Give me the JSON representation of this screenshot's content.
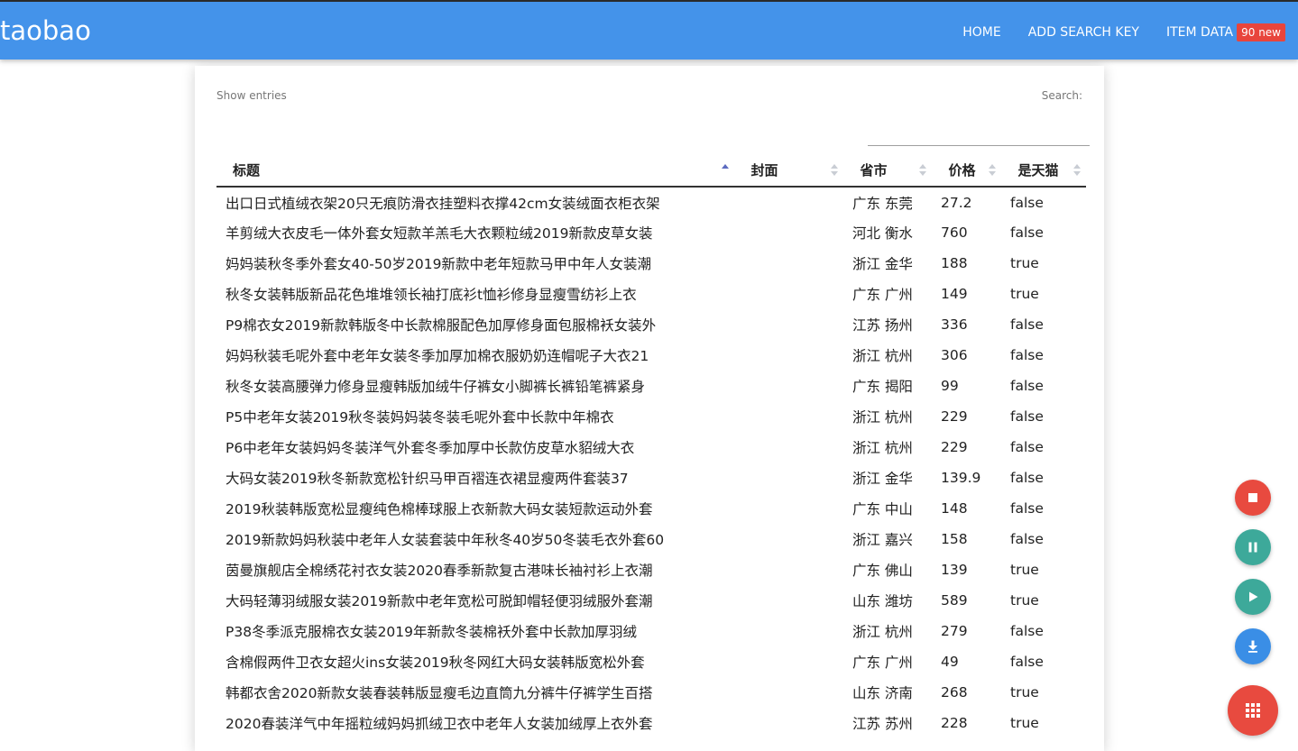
{
  "navbar": {
    "brand": "taobao",
    "links": {
      "home": "HOME",
      "add_search_key": "ADD SEARCH KEY",
      "item_data": "ITEM DATA"
    },
    "badge": "90 new"
  },
  "table_controls": {
    "show_entries": "Show entries",
    "search_label": "Search:",
    "search_value": ""
  },
  "table": {
    "columns": [
      "标题",
      "封面",
      "省市",
      "价格",
      "是天猫"
    ],
    "sorted_column": "标题",
    "sort_direction": "ascending",
    "rows": [
      {
        "title": "出口日式植绒衣架20只无痕防滑衣挂塑料衣撑42cm女装绒面衣柜衣架",
        "cover": "",
        "location": "广东 东莞",
        "price": "27.2",
        "tmall": "false"
      },
      {
        "title": "羊剪绒大衣皮毛一体外套女短款羊羔毛大衣颗粒绒2019新款皮草女装",
        "cover": "",
        "location": "河北 衡水",
        "price": "760",
        "tmall": "false"
      },
      {
        "title": "妈妈装秋冬季外套女40-50岁2019新款中老年短款马甲中年人女装潮",
        "cover": "",
        "location": "浙江 金华",
        "price": "188",
        "tmall": "true"
      },
      {
        "title": "秋冬女装韩版新品花色堆堆领长袖打底衫t恤衫修身显瘦雪纺衫上衣",
        "cover": "",
        "location": "广东 广州",
        "price": "149",
        "tmall": "true"
      },
      {
        "title": "P9棉衣女2019新款韩版冬中长款棉服配色加厚修身面包服棉袄女装外",
        "cover": "",
        "location": "江苏 扬州",
        "price": "336",
        "tmall": "false"
      },
      {
        "title": "妈妈秋装毛呢外套中老年女装冬季加厚加棉衣服奶奶连帽呢子大衣21",
        "cover": "",
        "location": "浙江 杭州",
        "price": "306",
        "tmall": "false"
      },
      {
        "title": "秋冬女装高腰弹力修身显瘦韩版加绒牛仔裤女小脚裤长裤铅笔裤紧身",
        "cover": "",
        "location": "广东 揭阳",
        "price": "99",
        "tmall": "false"
      },
      {
        "title": "P5中老年女装2019秋冬装妈妈装冬装毛呢外套中长款中年棉衣",
        "cover": "",
        "location": "浙江 杭州",
        "price": "229",
        "tmall": "false"
      },
      {
        "title": "P6中老年女装妈妈冬装洋气外套冬季加厚中长款仿皮草水貂绒大衣",
        "cover": "",
        "location": "浙江 杭州",
        "price": "229",
        "tmall": "false"
      },
      {
        "title": "大码女装2019秋冬新款宽松针织马甲百褶连衣裙显瘦两件套装37",
        "cover": "",
        "location": "浙江 金华",
        "price": "139.9",
        "tmall": "false"
      },
      {
        "title": "2019秋装韩版宽松显瘦纯色棉棒球服上衣新款大码女装短款运动外套",
        "cover": "",
        "location": "广东 中山",
        "price": "148",
        "tmall": "false"
      },
      {
        "title": "2019新款妈妈秋装中老年人女装套装中年秋冬40岁50冬装毛衣外套60",
        "cover": "",
        "location": "浙江 嘉兴",
        "price": "158",
        "tmall": "false"
      },
      {
        "title": "茵曼旗舰店全棉绣花衬衣女装2020春季新款复古港味长袖衬衫上衣潮",
        "cover": "",
        "location": "广东 佛山",
        "price": "139",
        "tmall": "true"
      },
      {
        "title": "大码轻薄羽绒服女装2019新款中老年宽松可脱卸帽轻便羽绒服外套潮",
        "cover": "",
        "location": "山东 潍坊",
        "price": "589",
        "tmall": "true"
      },
      {
        "title": "P38冬季派克服棉衣女装2019年新款冬装棉袄外套中长款加厚羽绒",
        "cover": "",
        "location": "浙江 杭州",
        "price": "279",
        "tmall": "false"
      },
      {
        "title": "含棉假两件卫衣女超火ins女装2019秋冬网红大码女装韩版宽松外套",
        "cover": "",
        "location": "广东 广州",
        "price": "49",
        "tmall": "false"
      },
      {
        "title": "韩都衣舍2020新款女装春装韩版显瘦毛边直筒九分裤牛仔裤学生百搭",
        "cover": "",
        "location": "山东 济南",
        "price": "268",
        "tmall": "true"
      },
      {
        "title": "2020春装洋气中年摇粒绒妈妈抓绒卫衣中老年人女装加绒厚上衣外套",
        "cover": "",
        "location": "江苏 苏州",
        "price": "228",
        "tmall": "true"
      }
    ]
  },
  "fabs": {
    "stop": {
      "icon": "stop-icon",
      "color": "#e84a3f"
    },
    "pause": {
      "icon": "pause-icon",
      "color": "#3da99a"
    },
    "play": {
      "icon": "play-icon",
      "color": "#3da99a"
    },
    "download": {
      "icon": "download-icon",
      "color": "#3a8ee6"
    },
    "menu": {
      "icon": "grid-menu-icon",
      "color": "#e84a3f"
    }
  },
  "colors": {
    "navbar": "#4493ea",
    "badge": "#e8453c",
    "sort_active": "#5c6bc0"
  }
}
